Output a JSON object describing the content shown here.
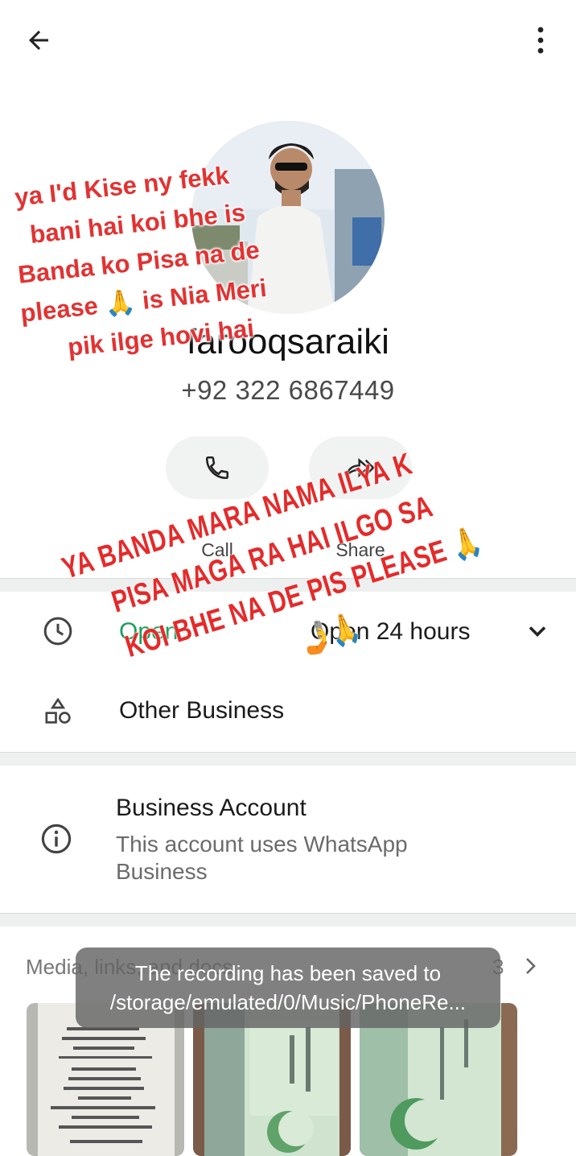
{
  "header": {
    "back_icon": "arrow-left-icon",
    "menu_icon": "more-vert-icon"
  },
  "contact": {
    "name": "farooqsaraiki",
    "phone": "+92 322 6867449"
  },
  "actions": [
    {
      "label": "Call",
      "icon": "phone-icon"
    },
    {
      "label": "Share",
      "icon": "share-icon"
    }
  ],
  "hours": {
    "status": "Open",
    "detail": "Open 24 hours",
    "icon": "clock-icon"
  },
  "category": {
    "label": "Other Business",
    "icon": "shapes-icon"
  },
  "business": {
    "title": "Business Account",
    "subtitle": "This account uses WhatsApp Business",
    "icon": "info-icon"
  },
  "media": {
    "label": "Media, links, and docs",
    "count": "3"
  },
  "toast": {
    "line1": "The recording has been saved to",
    "line2": "/storage/emulated/0/Music/PhoneRe..."
  },
  "overlay_note": {
    "lines": [
      "ya I'd Kise ny fekk",
      "bani hai koi bhe is",
      "Banda ko Pisa na de",
      "please 🙏 is Nia Meri",
      "pik ilge hovi hai"
    ]
  },
  "overlay_banner": {
    "lines": [
      "YA BANDA MARA NAMA ILYA K",
      "PISA MAGA RA HAI ILGO SA",
      "KOI BHE NA DE PIS  PLEASE 🙏",
      "🤳🙏"
    ]
  },
  "colors": {
    "accent_green": "#1d9e5a",
    "overlay_red": "#e23232"
  }
}
